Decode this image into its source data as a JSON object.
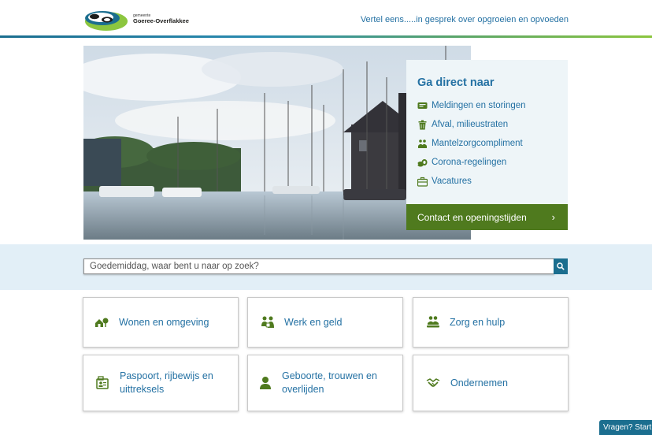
{
  "header": {
    "logo_small": "gemeente",
    "logo_name": "Goeree-Overflakkee",
    "tagline": "Vertel eens.....in gesprek over opgroeien en opvoeden"
  },
  "hero": {
    "image": "harbor-with-sailboats-photo"
  },
  "quick_links": {
    "title": "Ga direct naar",
    "items": [
      {
        "label": "Meldingen en storingen",
        "icon": "message-icon"
      },
      {
        "label": "Afval, milieustraten",
        "icon": "trash-icon"
      },
      {
        "label": "Mantelzorgcompliment",
        "icon": "care-icon"
      },
      {
        "label": "Corona-regelingen",
        "icon": "coins-icon"
      },
      {
        "label": "Vacatures",
        "icon": "briefcase-icon"
      }
    ],
    "contact_label": "Contact en openingstijden"
  },
  "search": {
    "placeholder": "Goedemiddag, waar bent u naar op zoek?"
  },
  "tiles": [
    {
      "label": "Wonen en omgeving",
      "icon": "house-tree-icon"
    },
    {
      "label": "Werk en geld",
      "icon": "people-money-icon"
    },
    {
      "label": "Zorg en hulp",
      "icon": "care-hands-icon"
    },
    {
      "label": "Paspoort, rijbewijs en uittreksels",
      "icon": "id-card-icon"
    },
    {
      "label": "Geboorte, trouwen en overlijden",
      "icon": "person-icon"
    },
    {
      "label": "Ondernemen",
      "icon": "handshake-icon"
    }
  ],
  "chat": {
    "label": "Vragen? Start c"
  },
  "colors": {
    "link_blue": "#2471a3",
    "green": "#4f7a1e",
    "teal": "#1b6e8f",
    "band": "#e2eff7"
  }
}
